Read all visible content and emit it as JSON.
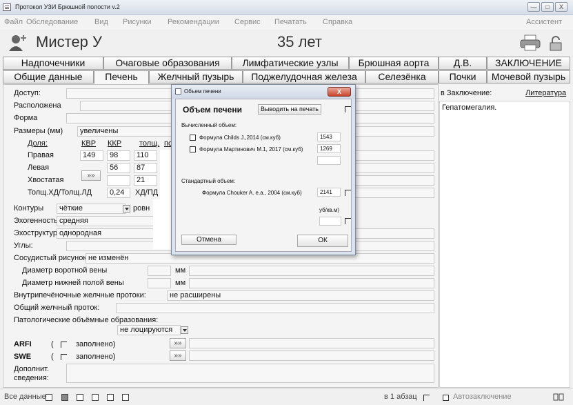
{
  "window": {
    "title": "Протокол УЗИ Брюшной полости v.2",
    "buttons": [
      "—",
      "□",
      "X"
    ]
  },
  "menu": [
    "Файл",
    "Обследование",
    "Вид",
    "Рисунки",
    "Рекомендации",
    "Сервис",
    "Печатать",
    "Справка",
    "Ассистент"
  ],
  "patient": {
    "name": "Мистер У",
    "age": "35 лет"
  },
  "tabs_row1": [
    "Надпочечники",
    "Очаговые образования",
    "Лимфатические узлы",
    "Брюшная аорта",
    "Д.В.",
    "ЗАКЛЮЧЕНИЕ"
  ],
  "tabs_row2": [
    "Общие данные",
    "Печень",
    "Желчный пузырь",
    "Поджелудочная железа",
    "Селезёнка",
    "Почки",
    "Мочевой пузырь"
  ],
  "form": {
    "access": "Доступ:",
    "location": "Расположена",
    "shape": "Форма",
    "sizes_label": "Размеры (мм)",
    "sizes_value": "увеличены",
    "col_lobe": "Доля:",
    "col_kvr": "КВР",
    "col_kkr": "ККР",
    "col_thick": "толщ.",
    "col_extra": "пс",
    "right": "Правая",
    "right_kvr": "149",
    "right_kkr": "98",
    "right_thick": "110",
    "left": "Левая",
    "left_kkr": "56",
    "left_thick": "87",
    "caudate": "Хвостатая",
    "caudate_btn": "»»",
    "caudate_thick": "21",
    "ratio_label": "Толщ.ХД/Толщ.ЛД",
    "ratio_value": "0,24",
    "ratio_unit": "ХД/ПД",
    "contours": "Контуры",
    "contours_value": "чёткие",
    "contours_second": "ровн",
    "echogenicity": "Эхогенность:",
    "echogenicity_value": "средняя",
    "echostructure": "Эхоструктура:",
    "echostructure_value": "однородная",
    "angles": "Углы:",
    "vascular": "Сосудистый рисунок:",
    "vascular_value": "не изменён",
    "portal": "Диаметр воротной вены",
    "ivc": "Диаметр нижней полой вены",
    "mm": "мм",
    "ducts": "Внутрипечёночные желчные протоки:",
    "ducts_value": "не расширены",
    "cbd": "Общий желчный проток:",
    "pathology": "Патологические объёмные образования:",
    "pathology_value": "не лоцируются",
    "arfi": "ARFI",
    "swe": "SWE",
    "paren_open": "(",
    "filled": "заполнено)",
    "more_btn": "»»",
    "extra": "Дополнит.",
    "extra2": "сведения:",
    "unit_partial": "уб/кв.м)"
  },
  "right_panel": {
    "conclusion_label": "в Заключение:",
    "literature": "Литература",
    "conclusion_text": "Гепатомегалия."
  },
  "dialog": {
    "title": "Объем печени",
    "heading": "Объем печени",
    "print_btn": "Выводить на печать",
    "calc_label": "Вычисленный объем:",
    "formula1": "Формула Childs J.,2014 (см.куб)",
    "formula1_value": "1543",
    "formula2": "Формула Мартинович М.1, 2017 (см.куб)",
    "formula2_value": "1269",
    "std_label": "Стандартный объем:",
    "formula3": "Формула Chouker A. e.a., 2004 (см.куб)",
    "formula3_value": "2141",
    "cancel": "Отмена",
    "ok": "ОК",
    "close": "X"
  },
  "statusbar": {
    "all_data": "Все данные",
    "paragraph": "в 1 абзац",
    "autoconclusion": "Автозаключение"
  }
}
